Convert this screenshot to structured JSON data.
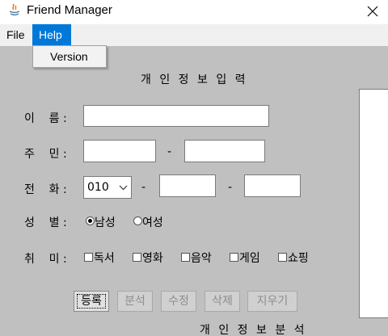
{
  "window": {
    "title": "Friend Manager",
    "icon": "java-icon",
    "close_icon": "close-icon"
  },
  "menubar": {
    "file": "File",
    "help": "Help"
  },
  "help_menu": {
    "items": [
      "Version"
    ]
  },
  "form": {
    "section_title": "개 인 정 보 입 력",
    "name_label": "이    름 :",
    "jumin_label": "주    민 :",
    "phone_label": "전    화 :",
    "gender_label": "성    별 :",
    "hobby_label": "취    미 :",
    "name_value": "",
    "jumin_front": "",
    "jumin_back": "",
    "dash": "-",
    "phone_prefix": "010",
    "phone_mid": "",
    "phone_last": "",
    "gender_options": [
      "남성",
      "여성"
    ],
    "gender_selected": "남성",
    "hobbies": [
      "독서",
      "영화",
      "음악",
      "게임",
      "쇼핑"
    ]
  },
  "buttons": {
    "register": "등록",
    "analyze": "분석",
    "modify": "수정",
    "delete": "삭제",
    "clear": "지우기"
  },
  "analysis": {
    "section_title": "개 인 정 보 분 석"
  },
  "colors": {
    "background": "#c0c0c0",
    "menu_highlight": "#0078d7",
    "disabled_text": "#8d8d8d"
  }
}
